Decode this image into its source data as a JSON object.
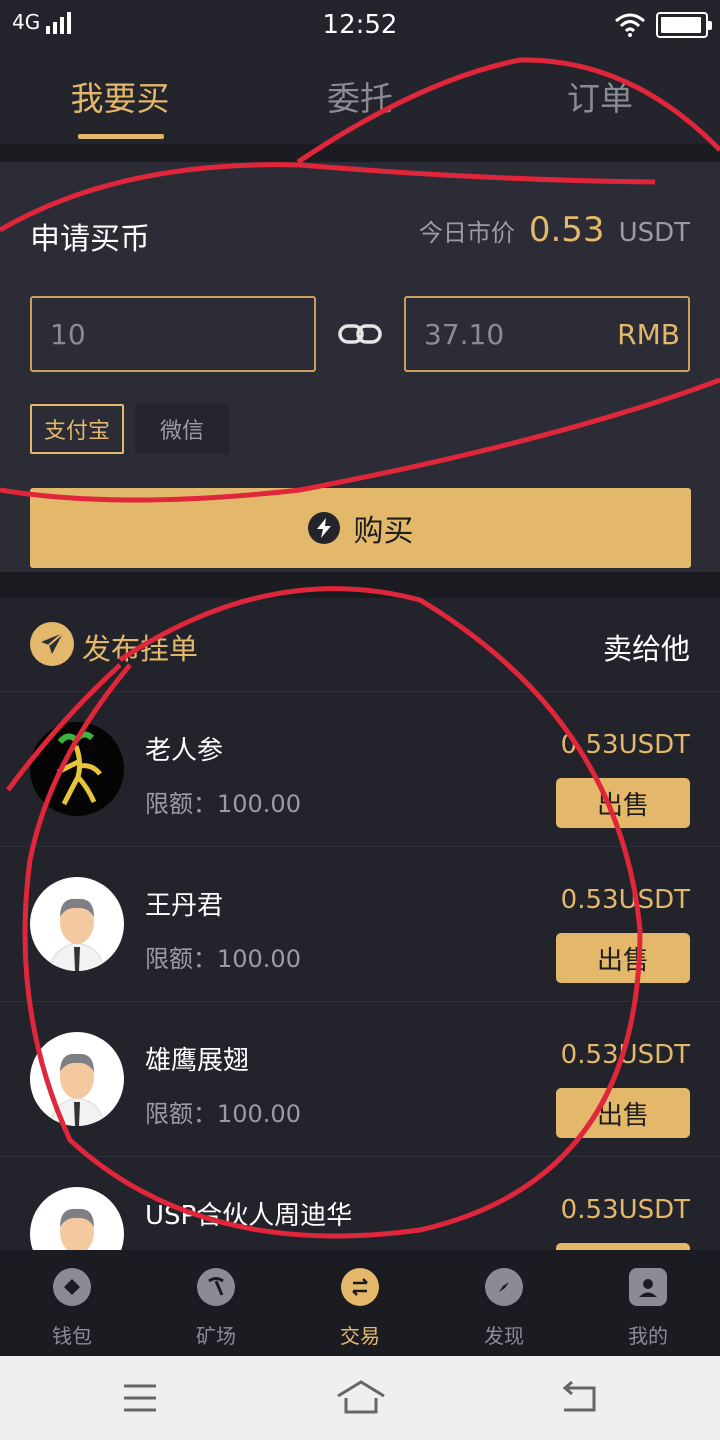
{
  "status": {
    "network": "4G",
    "time": "12:52",
    "battery_level": 0.95
  },
  "tabs": [
    {
      "label": "我要买",
      "active": true
    },
    {
      "label": "委托",
      "active": false
    },
    {
      "label": "订单",
      "active": false
    }
  ],
  "buy": {
    "title": "申请买币",
    "market_label": "今日市价",
    "market_price": "0.53",
    "market_unit": "USDT",
    "amount_value": "10",
    "rmb_value": "37.10",
    "rmb_unit": "RMB",
    "payment_methods": [
      {
        "label": "支付宝",
        "selected": true
      },
      {
        "label": "微信",
        "selected": false
      }
    ],
    "buy_button": "购买"
  },
  "list": {
    "publish_label": "发布挂单",
    "sell_to_label": "卖给他",
    "rows": [
      {
        "name": "老人参",
        "limit": "限额：100.00",
        "price": "0.53USDT",
        "action": "出售",
        "avatar": "ginseng-avatar"
      },
      {
        "name": "王丹君",
        "limit": "限额：100.00",
        "price": "0.53USDT",
        "action": "出售",
        "avatar": "person-avatar"
      },
      {
        "name": "雄鹰展翅",
        "limit": "限额：100.00",
        "price": "0.53USDT",
        "action": "出售",
        "avatar": "person-avatar"
      },
      {
        "name": "USP合伙人周迪华",
        "limit": "",
        "price": "0.53USDT",
        "action": "",
        "avatar": "person-avatar"
      }
    ]
  },
  "nav": [
    {
      "label": "钱包",
      "icon": "wallet-icon",
      "active": false
    },
    {
      "label": "矿场",
      "icon": "pickaxe-icon",
      "active": false
    },
    {
      "label": "交易",
      "icon": "exchange-icon",
      "active": true
    },
    {
      "label": "发现",
      "icon": "compass-icon",
      "active": false
    },
    {
      "label": "我的",
      "icon": "profile-icon",
      "active": false
    }
  ],
  "colors": {
    "accent": "#e3b86b",
    "background": "#22232b",
    "panel": "#2b2c35",
    "annotation": "#e0263a"
  }
}
